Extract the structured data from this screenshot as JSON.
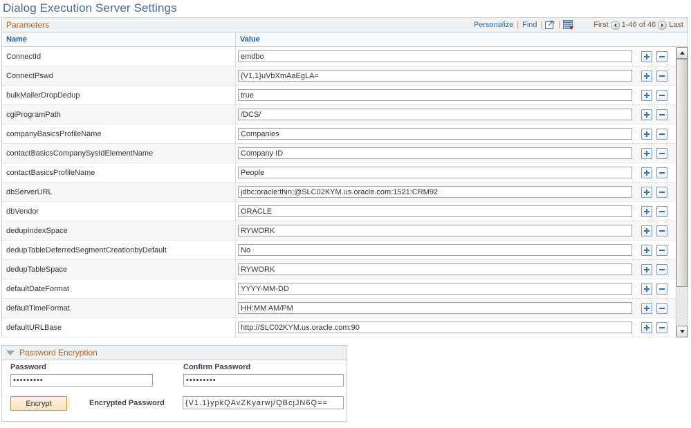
{
  "page": {
    "title": "Dialog Execution Server Settings"
  },
  "grid": {
    "caption": "Parameters",
    "toolbar": {
      "personalize_label": "Personalize",
      "find_label": "Find",
      "separator": "|",
      "new_window_icon": "new-window-icon",
      "download_icon": "download-to-excel-icon"
    },
    "nav": {
      "first_label": "First",
      "prev_icon": "left-arrow-icon",
      "range_label": "1-46 of 46",
      "next_icon": "right-arrow-icon",
      "last_label": "Last"
    },
    "columns": [
      "Name",
      "Value"
    ],
    "row_actions": {
      "add_label": "+",
      "remove_label": "-"
    },
    "rows": [
      {
        "name": "ConnectId",
        "value": "emdbo"
      },
      {
        "name": "ConnectPswd",
        "value": "{V1.1}uVbXmAaEgLA="
      },
      {
        "name": "bulkMailerDropDedup",
        "value": "true"
      },
      {
        "name": "cgiProgramPath",
        "value": "/DCS/"
      },
      {
        "name": "companyBasicsProfileName",
        "value": "Companies"
      },
      {
        "name": "contactBasicsCompanySysIdElementName",
        "value": "Company ID"
      },
      {
        "name": "contactBasicsProfileName",
        "value": "People"
      },
      {
        "name": "dbServerURL",
        "value": "jdbc:oracle:thin:@SLC02KYM.us.oracle.com:1521:CRM92"
      },
      {
        "name": "dbVendor",
        "value": "ORACLE"
      },
      {
        "name": "dedupIndexSpace",
        "value": "RYWORK"
      },
      {
        "name": "dedupTableDeferredSegmentCreationbyDefault",
        "value": "No"
      },
      {
        "name": "dedupTableSpace",
        "value": "RYWORK"
      },
      {
        "name": "defaultDateFormat",
        "value": "YYYY-MM-DD"
      },
      {
        "name": "defaultTimeFormat",
        "value": "HH:MM AM/PM"
      },
      {
        "name": "defaultURLBase",
        "value": "http://SLC02KYM.us.oracle.com:90"
      }
    ]
  },
  "password_encryption": {
    "title": "Password Encryption",
    "toggle_icon": "collapse-triangle-icon",
    "password_label": "Password",
    "password_value": "•••••••••",
    "confirm_label": "Confirm Password",
    "confirm_value": "•••••••••",
    "encrypt_button_label": "Encrypt",
    "encrypted_label": "Encrypted Password",
    "encrypted_value": "{V1.1}ypkQAvZKyarwj/QBcjJN6Q=="
  },
  "colors": {
    "title_blue": "#4a6c8f",
    "caption_orange": "#c06018",
    "column_header_blue": "#1f5c9e",
    "link_blue": "#3b6ea5",
    "nav_brown": "#7b5a3a",
    "button_border_orange": "#d08a2e"
  }
}
